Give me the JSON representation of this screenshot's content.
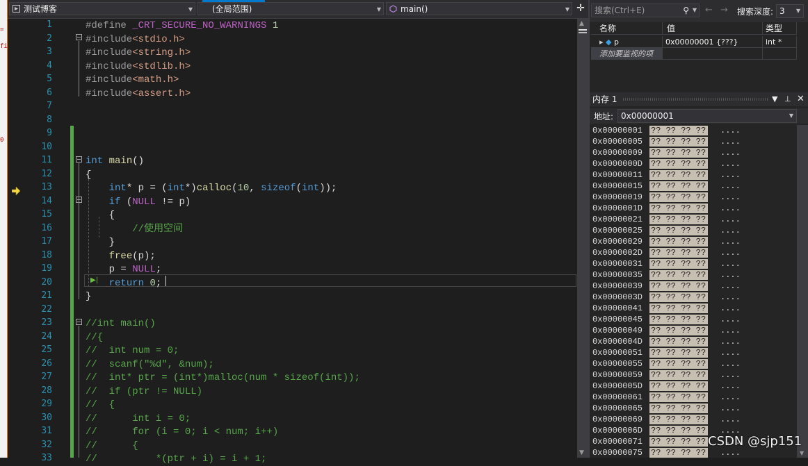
{
  "editor": {
    "project_dropdown": "测试博客",
    "scope_dropdown": "(全局范围)",
    "function_dropdown": "main()",
    "lines": [
      {
        "n": "1",
        "html": "<span class='pp'>#define</span> <span class='mac'>_CRT_SECURE_NO_WARNINGS</span> <span class='num'>1</span>"
      },
      {
        "n": "2",
        "html": "<span class='pp'>#include</span><span class='str'>&lt;stdio.h&gt;</span>"
      },
      {
        "n": "3",
        "html": "<span class='pp'>#include</span><span class='str'>&lt;string.h&gt;</span>"
      },
      {
        "n": "4",
        "html": "<span class='pp'>#include</span><span class='str'>&lt;stdlib.h&gt;</span>"
      },
      {
        "n": "5",
        "html": "<span class='pp'>#include</span><span class='str'>&lt;math.h&gt;</span>"
      },
      {
        "n": "6",
        "html": "<span class='pp'>#include</span><span class='str'>&lt;assert.h&gt;</span>"
      },
      {
        "n": "7",
        "html": ""
      },
      {
        "n": "8",
        "html": ""
      },
      {
        "n": "9",
        "html": ""
      },
      {
        "n": "10",
        "html": ""
      },
      {
        "n": "11",
        "html": "<span class='kw'>int</span> <span class='fn'>main</span>()"
      },
      {
        "n": "12",
        "html": "{"
      },
      {
        "n": "13",
        "html": "    <span class='kw'>int</span>* <span class='id'>p</span> = (<span class='kw'>int</span>*)<span class='fn'>calloc</span>(<span class='num'>10</span>, <span class='kw'>sizeof</span>(<span class='kw'>int</span>));"
      },
      {
        "n": "14",
        "html": "    <span class='kw'>if</span> (<span class='mac'>NULL</span> != <span class='id'>p</span>)"
      },
      {
        "n": "15",
        "html": "    {"
      },
      {
        "n": "16",
        "html": "        <span class='cm'>//使用空间</span>"
      },
      {
        "n": "17",
        "html": "    }"
      },
      {
        "n": "18",
        "html": "    <span class='fn'>free</span>(<span class='id'>p</span>);"
      },
      {
        "n": "19",
        "html": "    <span class='id'>p</span> = <span class='mac'>NULL</span>;"
      },
      {
        "n": "20",
        "html": "    <span class='kw'>return</span> <span class='num'>0</span>;"
      },
      {
        "n": "21",
        "html": "}"
      },
      {
        "n": "22",
        "html": ""
      },
      {
        "n": "23",
        "html": "<span class='cm'>//int main()</span>"
      },
      {
        "n": "24",
        "html": "<span class='cm'>//{</span>"
      },
      {
        "n": "25",
        "html": "<span class='cm'>//  int num = 0;</span>"
      },
      {
        "n": "26",
        "html": "<span class='cm'>//  scanf(\"%d\", &amp;num);</span>"
      },
      {
        "n": "27",
        "html": "<span class='cm'>//  int* ptr = (int*)malloc(num * sizeof(int));</span>"
      },
      {
        "n": "28",
        "html": "<span class='cm'>//  if (ptr != NULL)</span>"
      },
      {
        "n": "29",
        "html": "<span class='cm'>//  {</span>"
      },
      {
        "n": "30",
        "html": "<span class='cm'>//      int i = 0;</span>"
      },
      {
        "n": "31",
        "html": "<span class='cm'>//      for (i = 0; i &lt; num; i++)</span>"
      },
      {
        "n": "32",
        "html": "<span class='cm'>//      {</span>"
      },
      {
        "n": "33",
        "html": "<span class='cm'>//          *(ptr + i) = i + 1;</span>"
      }
    ]
  },
  "watch": {
    "search_placeholder": "搜索(Ctrl+E)",
    "depth_label": "搜索深度:",
    "depth_value": "3",
    "columns": {
      "name": "名称",
      "value": "值",
      "type": "类型"
    },
    "rows": [
      {
        "name": "p",
        "value": "0x00000001 {???}",
        "type": "int *"
      }
    ],
    "add_item": "添加要监视的项"
  },
  "memory": {
    "title": "内存 1",
    "address_label": "地址:",
    "address_value": "0x00000001",
    "bytes": "?? ?? ?? ??",
    "chars": "....",
    "rows": [
      "0x00000001",
      "0x00000005",
      "0x00000009",
      "0x0000000D",
      "0x00000011",
      "0x00000015",
      "0x00000019",
      "0x0000001D",
      "0x00000021",
      "0x00000025",
      "0x00000029",
      "0x0000002D",
      "0x00000031",
      "0x00000035",
      "0x00000039",
      "0x0000003D",
      "0x00000041",
      "0x00000045",
      "0x00000049",
      "0x0000004D",
      "0x00000051",
      "0x00000055",
      "0x00000059",
      "0x0000005D",
      "0x00000061",
      "0x00000065",
      "0x00000069",
      "0x0000006D",
      "0x00000071",
      "0x00000075"
    ]
  },
  "watermark": "CSDN @sjp151"
}
